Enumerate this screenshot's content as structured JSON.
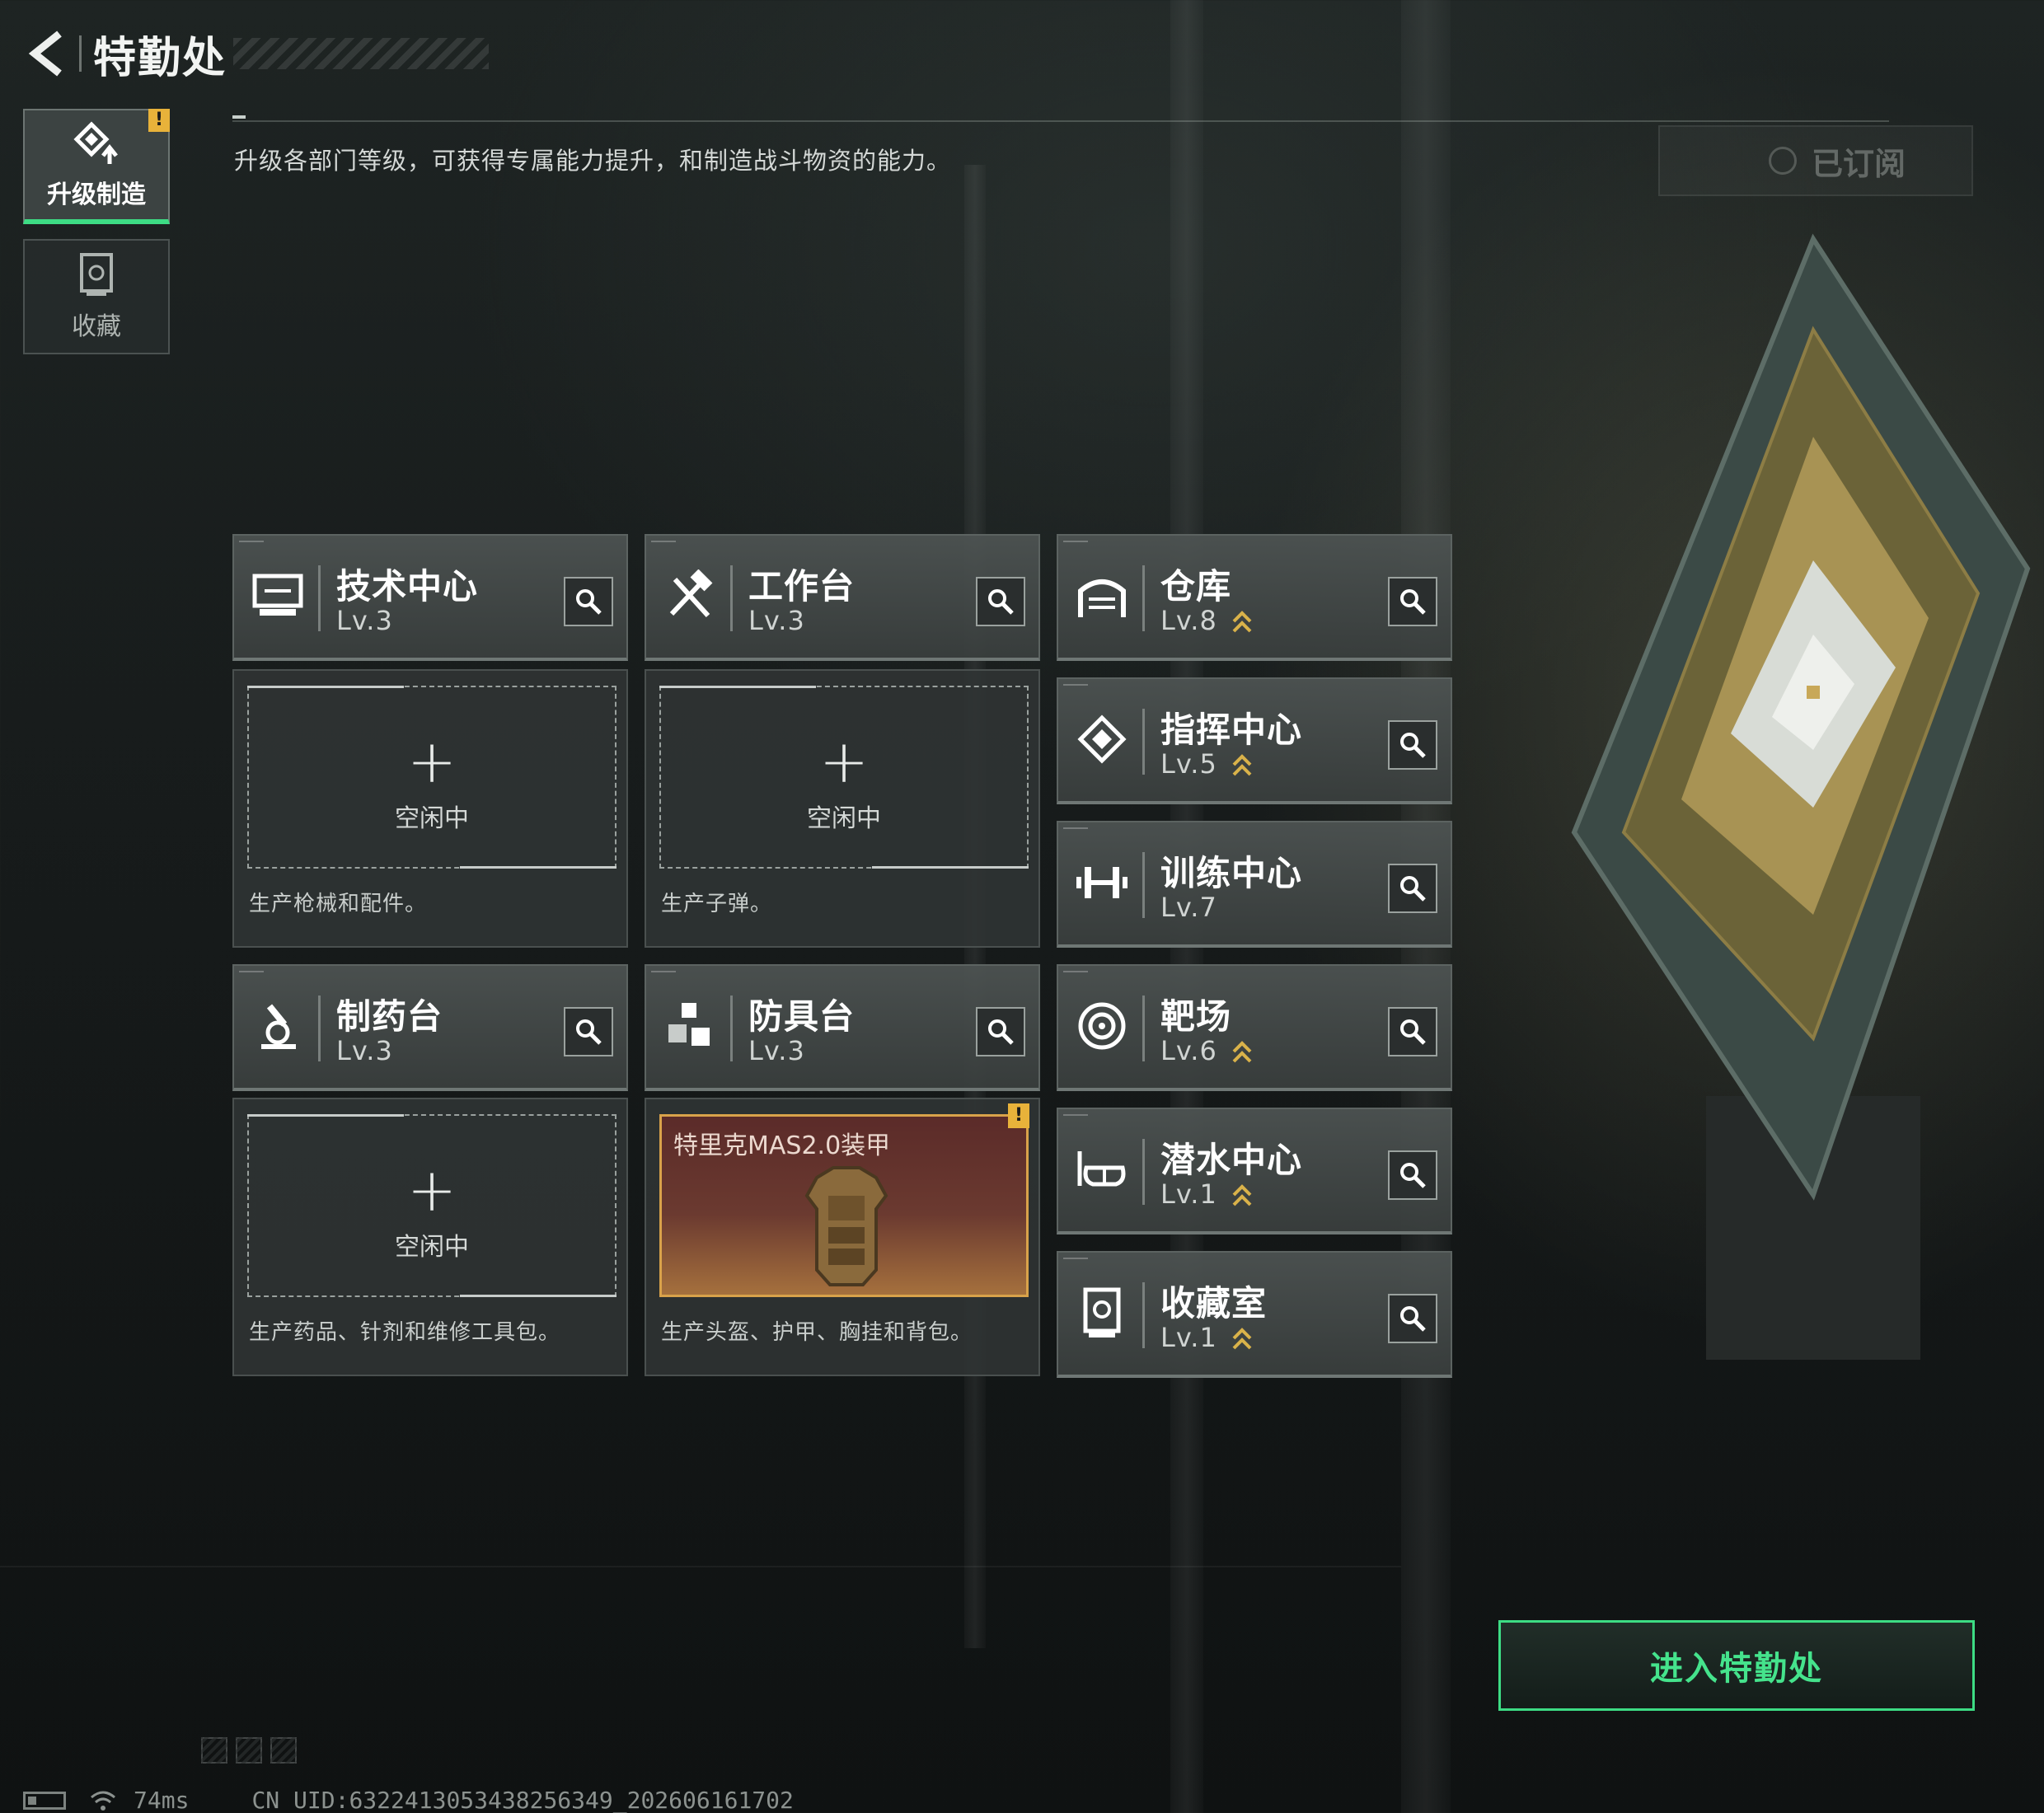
{
  "header": {
    "title": "特勤处",
    "back_icon": "chevron-left-icon"
  },
  "nav": {
    "items": [
      {
        "label": "升级制造",
        "icon": "upgrade-icon",
        "active": true,
        "badge": "!"
      },
      {
        "label": "收藏",
        "icon": "collection-icon",
        "active": false
      }
    ]
  },
  "description": "升级各部门等级，可获得专属能力提升，和制造战斗物资的能力。",
  "subscribe": {
    "label": "已订阅"
  },
  "departments": {
    "tech": {
      "name": "技术中心",
      "level": "Lv.3",
      "icon": "monitor-icon",
      "slot_status": "空闲中",
      "desc": "生产枪械和配件。"
    },
    "workbench": {
      "name": "工作台",
      "level": "Lv.3",
      "icon": "tools-icon",
      "slot_status": "空闲中",
      "desc": "生产子弹。"
    },
    "pharmacy": {
      "name": "制药台",
      "level": "Lv.3",
      "icon": "microscope-icon",
      "slot_status": "空闲中",
      "desc": "生产药品、针剂和维修工具包。"
    },
    "armory": {
      "name": "防具台",
      "level": "Lv.3",
      "icon": "cubes-icon",
      "item_name": "特里克MAS2.0装甲",
      "item_badge": "!",
      "desc": "生产头盔、护甲、胸挂和背包。"
    },
    "warehouse": {
      "name": "仓库",
      "level": "Lv.8",
      "icon": "garage-icon",
      "upgradable": true
    },
    "command": {
      "name": "指挥中心",
      "level": "Lv.5",
      "icon": "chip-icon",
      "upgradable": true
    },
    "training": {
      "name": "训练中心",
      "level": "Lv.7",
      "icon": "dumbbell-icon",
      "upgradable": false
    },
    "range": {
      "name": "靶场",
      "level": "Lv.6",
      "icon": "target-icon",
      "upgradable": true
    },
    "diving": {
      "name": "潜水中心",
      "level": "Lv.1",
      "icon": "diving-mask-icon",
      "upgradable": true
    },
    "vault": {
      "name": "收藏室",
      "level": "Lv.1",
      "icon": "vault-icon",
      "upgradable": true
    }
  },
  "enter_button": {
    "label": "进入特勤处"
  },
  "status": {
    "ping": "74ms",
    "uid": "CN UID:6322413053438256349_202606161702"
  },
  "colors": {
    "accent": "#3ddc84",
    "warning": "#e8b23a",
    "item_border": "#d9a24a"
  }
}
